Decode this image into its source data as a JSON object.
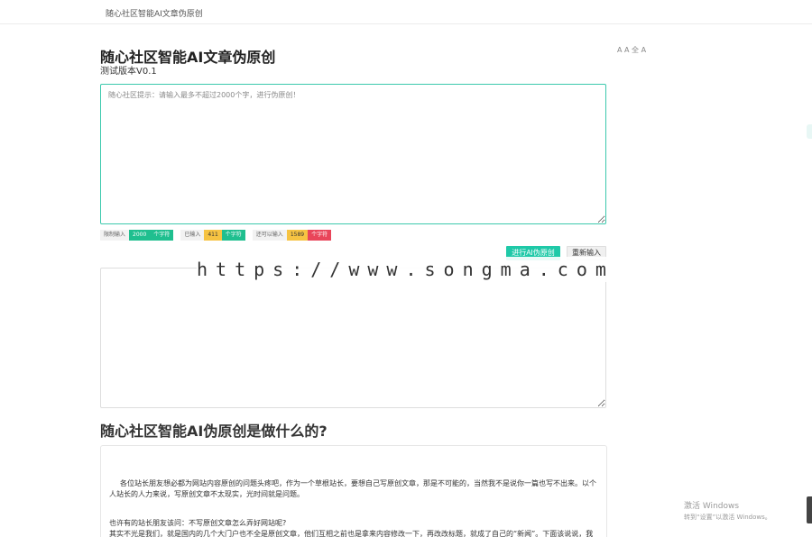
{
  "header": {
    "brand": "随心社区智能AI文章伪原创"
  },
  "main": {
    "title": "随心社区智能AI文章伪原创",
    "version": "测试版本V0.1",
    "side_note": "A A 全 A",
    "input_placeholder": "随心社区提示：请输入最多不超过2000个字，进行伪原创！",
    "counters": [
      {
        "label": "限制输入",
        "value": "2000",
        "unit": "个字符"
      },
      {
        "label": "已输入",
        "value": "411",
        "unit": "个字符"
      },
      {
        "label": "还可以输入",
        "value": "1589",
        "unit": "个字符"
      }
    ],
    "primary_button": "进行AI伪原创",
    "secondary_button": "重新输入",
    "watermark": "https://www.songma.com"
  },
  "faq": {
    "title": "随心社区智能AI伪原创是做什么的?",
    "paragraph1": "各位站长朋友想必都为网站内容原创的问题头疼吧，作为一个草根站长，要想自己写原创文章，那是不可能的，当然我不是说你一篇也写不出来。以个人站长的人力来说，写原创文章不太现实，光时间就是问题。",
    "paragraph2_line1": "也许有的站长朋友该问：不写原创文章怎么弄好网站呢?",
    "paragraph2_line2": "其实不光是我们，就是国内的几个大门户也不全是原创文章，他们互相之前也是拿来内容修改一下，再改改标题，就成了自己的“新闻”。下面该说说，我"
  },
  "system": {
    "activate_title": "激活 Windows",
    "activate_sub": "转到“设置”以激活 Windows。"
  },
  "colors": {
    "accent": "#1fc9a8",
    "warning": "#f6c342",
    "danger": "#e9455a"
  }
}
